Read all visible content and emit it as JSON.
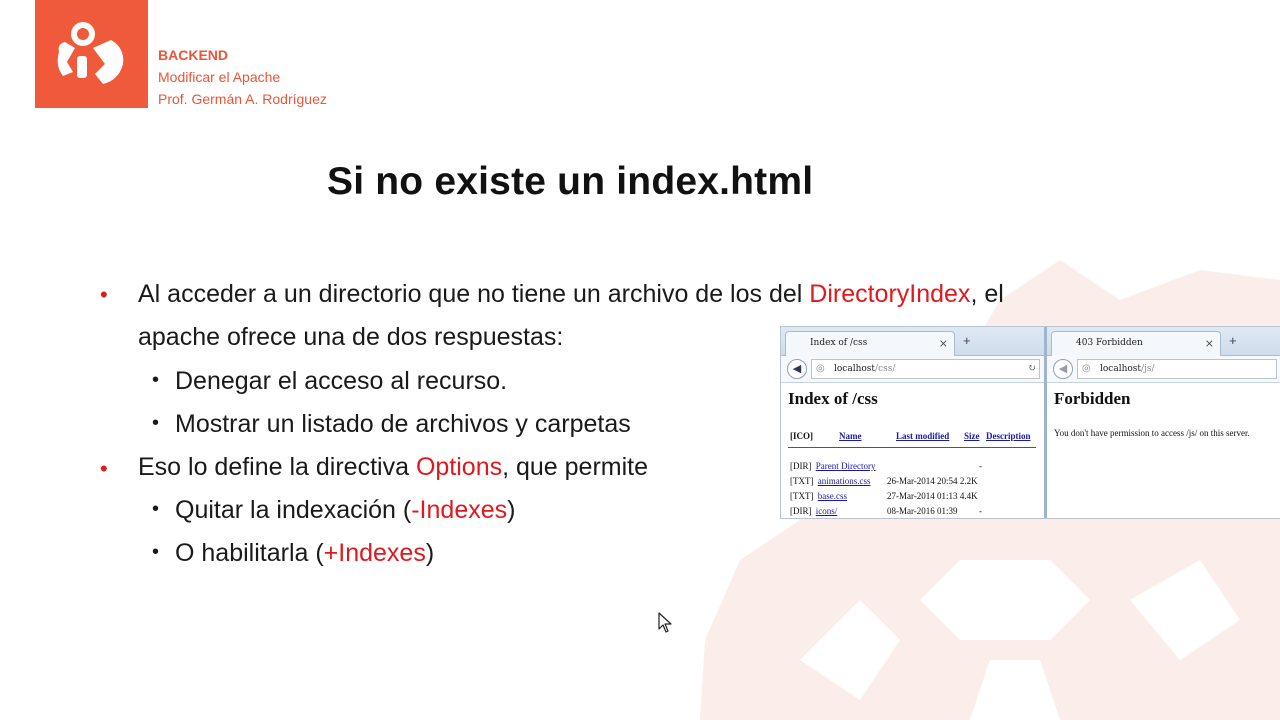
{
  "header": {
    "course": "BACKEND",
    "subtitle": "Modificar el Apache",
    "professor": "Prof. Germán A. Rodríguez"
  },
  "slide": {
    "title": "Si no existe un index.html",
    "bullets": {
      "b1_part1": "Al acceder a un directorio que no tiene un archivo de los del ",
      "b1_highlight": "DirectoryIndex",
      "b1_part2": ", el",
      "b1_line2": "apache ofrece una de dos respuestas:",
      "sub1": "Denegar el acceso al recurso.",
      "sub2": "Mostrar un listado de archivos y carpetas",
      "b2_part1": "Eso lo define la directiva ",
      "b2_highlight": "Options",
      "b2_part2": ", que permite",
      "sub3_part1": "Quitar la indexación (",
      "sub3_highlight": "-Indexes",
      "sub3_part2": ")",
      "sub4_part1": "O habilitarla (",
      "sub4_highlight": "+Indexes",
      "sub4_part2": ")"
    }
  },
  "screenshot": {
    "left": {
      "tab_title": "Index of /css",
      "url_host": "localhost",
      "url_path": "/css/",
      "heading": "Index of /css",
      "columns": [
        "[ICO]",
        "Name",
        "Last modified",
        "Size",
        "Description"
      ],
      "rows": [
        {
          "type": "[DIR]",
          "name": "Parent Directory",
          "modified": "",
          "size": "-"
        },
        {
          "type": "[TXT]",
          "name": "animations.css",
          "modified": "26-Mar-2014 20:54",
          "size": "2.2K"
        },
        {
          "type": "[TXT]",
          "name": "base.css",
          "modified": "27-Mar-2014 01:13",
          "size": "4.4K"
        },
        {
          "type": "[DIR]",
          "name": "icons/",
          "modified": "08-Mar-2016 01:39",
          "size": "-"
        }
      ]
    },
    "right": {
      "tab_title": "403 Forbidden",
      "url_host": "localhost",
      "url_path": "/js/",
      "heading": "Forbidden",
      "message": "You don't have permission to access /js/ on this server."
    }
  },
  "colors": {
    "accent": "#ee5a3a",
    "highlight": "#e0191f"
  },
  "icons": {
    "logo": "gear-wrench-logo",
    "watermark": "gear-watermark",
    "cursor": "mouse-pointer-icon"
  }
}
